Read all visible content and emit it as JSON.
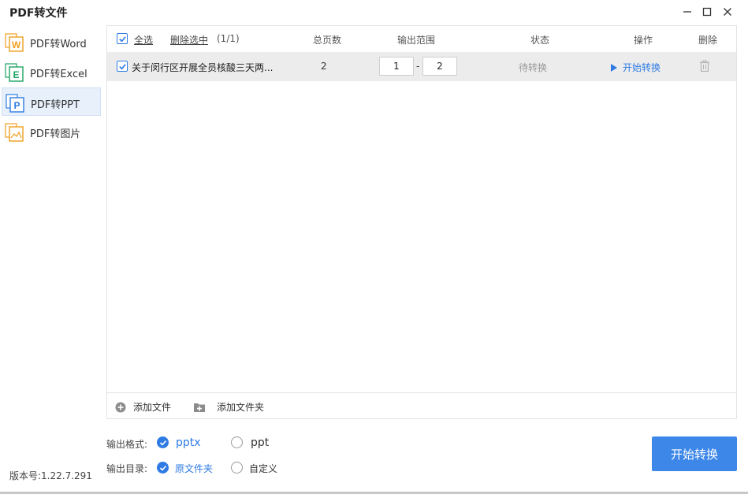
{
  "window": {
    "title": "PDF转文件"
  },
  "sidebar": {
    "items": [
      {
        "label": "PDF转Word",
        "icon": "word-icon",
        "color": "#f0a020"
      },
      {
        "label": "PDF转Excel",
        "icon": "excel-icon",
        "color": "#1fa463"
      },
      {
        "label": "PDF转PPT",
        "icon": "ppt-icon",
        "color": "#2e7be4",
        "active": true
      },
      {
        "label": "PDF转图片",
        "icon": "image-icon",
        "color": "#f0a020"
      }
    ],
    "version": "版本号:1.22.7.291"
  },
  "table": {
    "select_all": "全选",
    "delete_selected": "删除选中",
    "count": "(1/1)",
    "headers": {
      "pages": "总页数",
      "range": "输出范围",
      "status": "状态",
      "action": "操作",
      "delete": "删除"
    },
    "rows": [
      {
        "checked": true,
        "filename": "关于闵行区开展全员核酸三天两...",
        "pages": "2",
        "range_from": "1",
        "range_sep": "-",
        "range_to": "2",
        "status": "待转换",
        "action": "开始转换"
      }
    ]
  },
  "footer": {
    "add_file": "添加文件",
    "add_folder": "添加文件夹"
  },
  "options": {
    "format_label": "输出格式:",
    "format_selected": "pptx",
    "format_other": "ppt",
    "dir_label": "输出目录:",
    "dir_selected": "原文件夹",
    "dir_other": "自定义"
  },
  "start_button": "开始转换",
  "colors": {
    "accent": "#2e7be4",
    "row_bg": "#ececec",
    "status_muted": "#999999"
  }
}
